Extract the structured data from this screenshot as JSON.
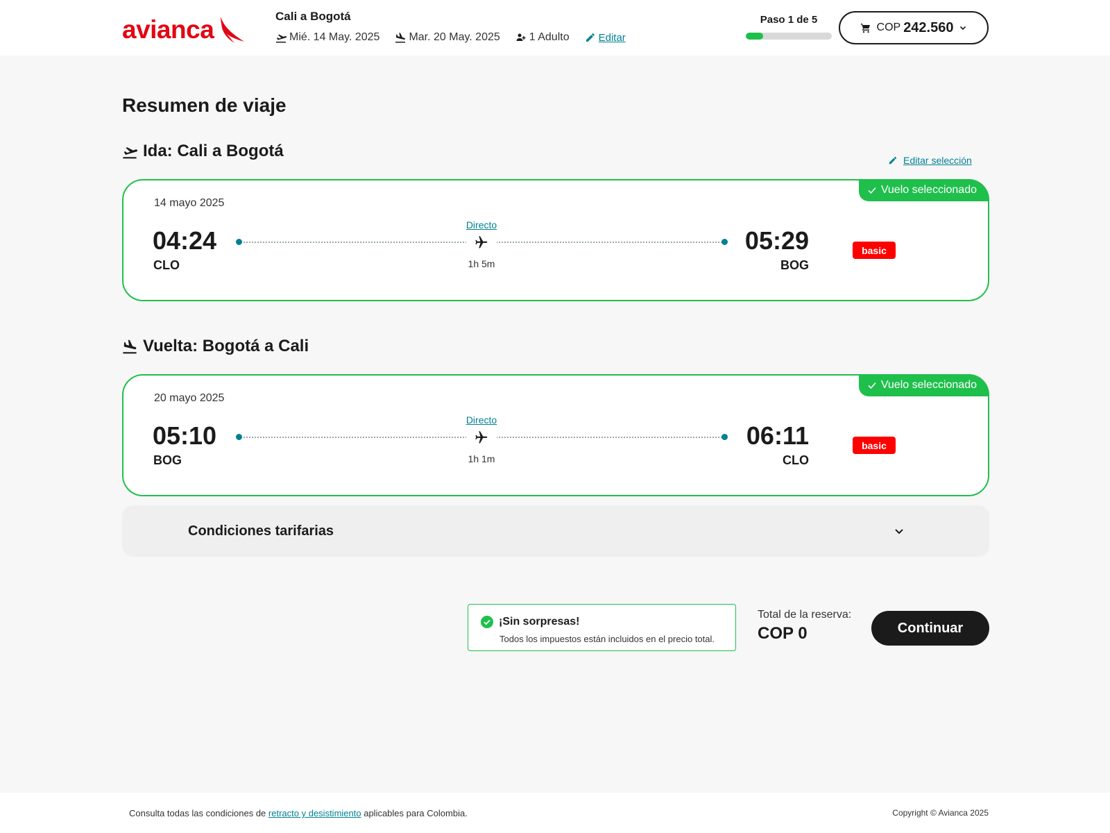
{
  "header": {
    "logo_text": "avianca",
    "route": "Cali a Bogotá",
    "departure_date": "Mié. 14 May. 2025",
    "return_date": "Mar. 20 May. 2025",
    "passengers": "1 Adulto",
    "edit_label": "Editar",
    "step_label": "Paso 1 de 5",
    "step_progress": 0.2,
    "cart_currency": "COP",
    "cart_amount": "242.560"
  },
  "main": {
    "page_title": "Resumen de viaje",
    "edit_selection_label": "Editar selección",
    "outbound": {
      "title": "Ida: Cali a Bogotá",
      "selected_badge": "Vuelo seleccionado",
      "date": "14 mayo 2025",
      "dep_time": "04:24",
      "dep_code": "CLO",
      "arr_time": "05:29",
      "arr_code": "BOG",
      "stops": "Directo",
      "duration": "1h 5m",
      "fare": "basic"
    },
    "inbound": {
      "title": "Vuelta: Bogotá a Cali",
      "selected_badge": "Vuelo seleccionado",
      "date": "20 mayo 2025",
      "dep_time": "05:10",
      "dep_code": "BOG",
      "arr_time": "06:11",
      "arr_code": "CLO",
      "stops": "Directo",
      "duration": "1h 1m",
      "fare": "basic"
    },
    "conditions_label": "Condiciones tarifarias",
    "no_surprises_title": "¡Sin sorpresas!",
    "no_surprises_text": "Todos los impuestos están incluidos en el precio total.",
    "total_label": "Total de la reserva:",
    "total_value": "COP 0",
    "continue_label": "Continuar"
  },
  "footer": {
    "legal_prefix": "Consulta todas las condiciones de",
    "legal_link": "retracto y desistimiento",
    "legal_suffix": "aplicables para Colombia.",
    "copyright": "Copyright © Avianca 2025"
  },
  "colors": {
    "brand_red": "#e30613",
    "accent_green": "#1fbf4c",
    "link_teal": "#008193",
    "fare_red": "#ff0000"
  }
}
